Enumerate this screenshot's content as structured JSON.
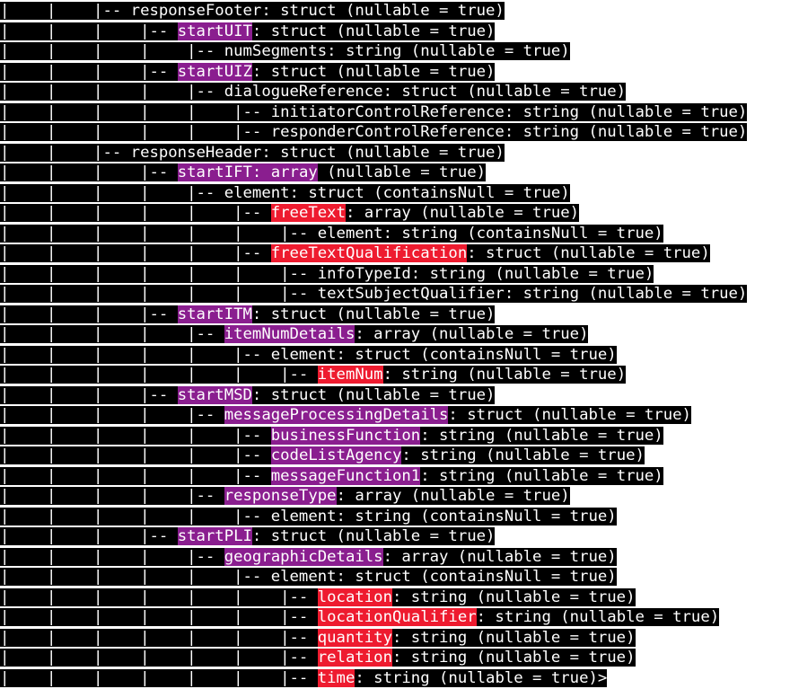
{
  "colors": {
    "line_bg": "#000000",
    "text": "#ffffff",
    "purple_highlight": "#8a1e8f",
    "red_highlight": "#ee1b2f"
  },
  "lines": [
    {
      "segments": [
        {
          "t": "|    |    |-- responseFooter: struct (nullable = true)"
        }
      ]
    },
    {
      "segments": [
        {
          "t": "|    |    |    |-- "
        },
        {
          "t": "startUIT",
          "hl": "purple"
        },
        {
          "t": ": struct (nullable = true)"
        }
      ]
    },
    {
      "segments": [
        {
          "t": "|    |    |    |    |-- numSegments: string (nullable = true)"
        }
      ]
    },
    {
      "segments": [
        {
          "t": "|    |    |    |-- "
        },
        {
          "t": "startUIZ",
          "hl": "purple"
        },
        {
          "t": ": struct (nullable = true)"
        }
      ]
    },
    {
      "segments": [
        {
          "t": "|    |    |    |    |-- dialogueReference: struct (nullable = true)"
        }
      ]
    },
    {
      "segments": [
        {
          "t": "|    |    |    |    |    |-- initiatorControlReference: string (nullable = true)"
        }
      ]
    },
    {
      "segments": [
        {
          "t": "|    |    |    |    |    |-- responderControlReference: string (nullable = true)"
        }
      ]
    },
    {
      "segments": [
        {
          "t": "|    |    |-- responseHeader: struct (nullable = true)"
        }
      ]
    },
    {
      "segments": [
        {
          "t": "|    |    |    |-- "
        },
        {
          "t": "startIFT: array",
          "hl": "purple"
        },
        {
          "t": " (nullable = true)"
        }
      ]
    },
    {
      "segments": [
        {
          "t": "|    |    |    |    |-- element: struct (containsNull = true)"
        }
      ]
    },
    {
      "segments": [
        {
          "t": "|    |    |    |    |    |-- "
        },
        {
          "t": "freeText",
          "hl": "red"
        },
        {
          "t": ": array (nullable = true)"
        }
      ]
    },
    {
      "segments": [
        {
          "t": "|    |    |    |    |    |    |-- element: string (containsNull = true)"
        }
      ]
    },
    {
      "segments": [
        {
          "t": "|    |    |    |    |    |-- "
        },
        {
          "t": "freeTextQualification",
          "hl": "red"
        },
        {
          "t": ": struct (nullable = true)"
        }
      ]
    },
    {
      "segments": [
        {
          "t": "|    |    |    |    |    |    |-- infoTypeId: string (nullable = true)"
        }
      ]
    },
    {
      "segments": [
        {
          "t": "|    |    |    |    |    |    |-- textSubjectQualifier: string (nullable = true)"
        }
      ]
    },
    {
      "segments": [
        {
          "t": "|    |    |    |-- "
        },
        {
          "t": "startITM",
          "hl": "purple"
        },
        {
          "t": ": struct (nullable = true)"
        }
      ]
    },
    {
      "segments": [
        {
          "t": "|    |    |    |    |-- "
        },
        {
          "t": "itemNumDetails",
          "hl": "purple"
        },
        {
          "t": ": array (nullable = true)"
        }
      ]
    },
    {
      "segments": [
        {
          "t": "|    |    |    |    |    |-- element: struct (containsNull = true)"
        }
      ]
    },
    {
      "segments": [
        {
          "t": "|    |    |    |    |    |    |-- "
        },
        {
          "t": "itemNum",
          "hl": "red"
        },
        {
          "t": ": string (nullable = true)"
        }
      ]
    },
    {
      "segments": [
        {
          "t": "|    |    |    |-- "
        },
        {
          "t": "startMSD",
          "hl": "purple"
        },
        {
          "t": ": struct (nullable = true)"
        }
      ]
    },
    {
      "segments": [
        {
          "t": "|    |    |    |    |-- "
        },
        {
          "t": "messageProcessingDetails",
          "hl": "purple"
        },
        {
          "t": ": struct (nullable = true)"
        }
      ]
    },
    {
      "segments": [
        {
          "t": "|    |    |    |    |    |-- "
        },
        {
          "t": "businessFunction",
          "hl": "purple"
        },
        {
          "t": ": string (nullable = true)"
        }
      ]
    },
    {
      "segments": [
        {
          "t": "|    |    |    |    |    |-- "
        },
        {
          "t": "codeListAgency",
          "hl": "purple"
        },
        {
          "t": ": string (nullable = true)"
        }
      ]
    },
    {
      "segments": [
        {
          "t": "|    |    |    |    |    |-- "
        },
        {
          "t": "messageFunction1",
          "hl": "purple"
        },
        {
          "t": ": string (nullable = true)"
        }
      ]
    },
    {
      "segments": [
        {
          "t": "|    |    |    |    |-- "
        },
        {
          "t": "responseType",
          "hl": "purple"
        },
        {
          "t": ": array (nullable = true)"
        }
      ]
    },
    {
      "segments": [
        {
          "t": "|    |    |    |    |    |-- element: string (containsNull = true)"
        }
      ]
    },
    {
      "segments": [
        {
          "t": "|    |    |    |-- "
        },
        {
          "t": "startPLI",
          "hl": "purple"
        },
        {
          "t": ": struct (nullable = true)"
        }
      ]
    },
    {
      "segments": [
        {
          "t": "|    |    |    |    |-- "
        },
        {
          "t": "geographicDetails",
          "hl": "purple"
        },
        {
          "t": ": array (nullable = true)"
        }
      ]
    },
    {
      "segments": [
        {
          "t": "|    |    |    |    |    |-- element: struct (containsNull = true)"
        }
      ]
    },
    {
      "segments": [
        {
          "t": "|    |    |    |    |    |    |-- "
        },
        {
          "t": "location",
          "hl": "red"
        },
        {
          "t": ": string (nullable = true)"
        }
      ]
    },
    {
      "segments": [
        {
          "t": "|    |    |    |    |    |    |-- "
        },
        {
          "t": "locationQualifier",
          "hl": "red"
        },
        {
          "t": ": string (nullable = true)"
        }
      ]
    },
    {
      "segments": [
        {
          "t": "|    |    |    |    |    |    |-- "
        },
        {
          "t": "quantity",
          "hl": "red"
        },
        {
          "t": ": string (nullable = true)"
        }
      ]
    },
    {
      "segments": [
        {
          "t": "|    |    |    |    |    |    |-- "
        },
        {
          "t": "relation",
          "hl": "red"
        },
        {
          "t": ": string (nullable = true)"
        }
      ]
    },
    {
      "segments": [
        {
          "t": "|    |    |    |    |    |    |-- "
        },
        {
          "t": "time",
          "hl": "red"
        },
        {
          "t": ": string (nullable = true)>"
        }
      ]
    }
  ]
}
